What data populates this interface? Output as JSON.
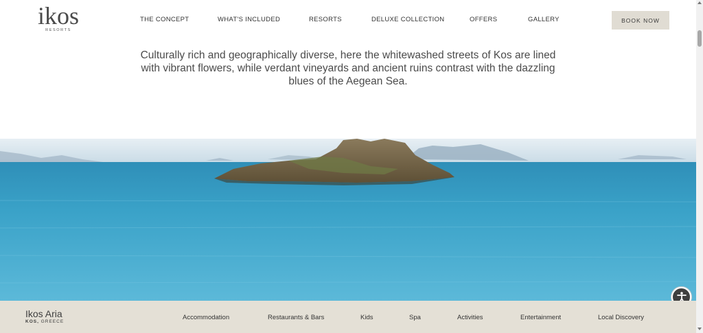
{
  "header": {
    "logo": {
      "word": "ikos",
      "sub": "RESORTS"
    },
    "nav": [
      {
        "label": "THE CONCEPT"
      },
      {
        "label": "WHAT'S INCLUDED"
      },
      {
        "label": "RESORTS"
      },
      {
        "label": "DELUXE COLLECTION"
      },
      {
        "label": "OFFERS"
      },
      {
        "label": "GALLERY"
      }
    ],
    "book_label": "BOOK NOW"
  },
  "intro": {
    "text": "Culturally rich and geographically diverse, here the whitewashed streets of Kos are lined with vibrant flowers, while verdant vineyards and ancient ruins contrast with the dazzling blues of the Aegean Sea."
  },
  "hero": {
    "subject": "island-in-aegean-sea"
  },
  "resort_bar": {
    "name": "Ikos Aria",
    "location_strong": "KOS,",
    "location_rest": "GREECE",
    "items": [
      {
        "label": "Accommodation"
      },
      {
        "label": "Restaurants & Bars"
      },
      {
        "label": "Kids"
      },
      {
        "label": "Spa"
      },
      {
        "label": "Activities"
      },
      {
        "label": "Entertainment"
      },
      {
        "label": "Local Discovery"
      }
    ]
  },
  "colors": {
    "sea": "#4aaed0",
    "sky": "#dde9f0",
    "bar_bg": "#e4e0d6",
    "button_bg": "#e0dcd3"
  },
  "icons": {
    "accessibility": "accessibility-icon"
  }
}
